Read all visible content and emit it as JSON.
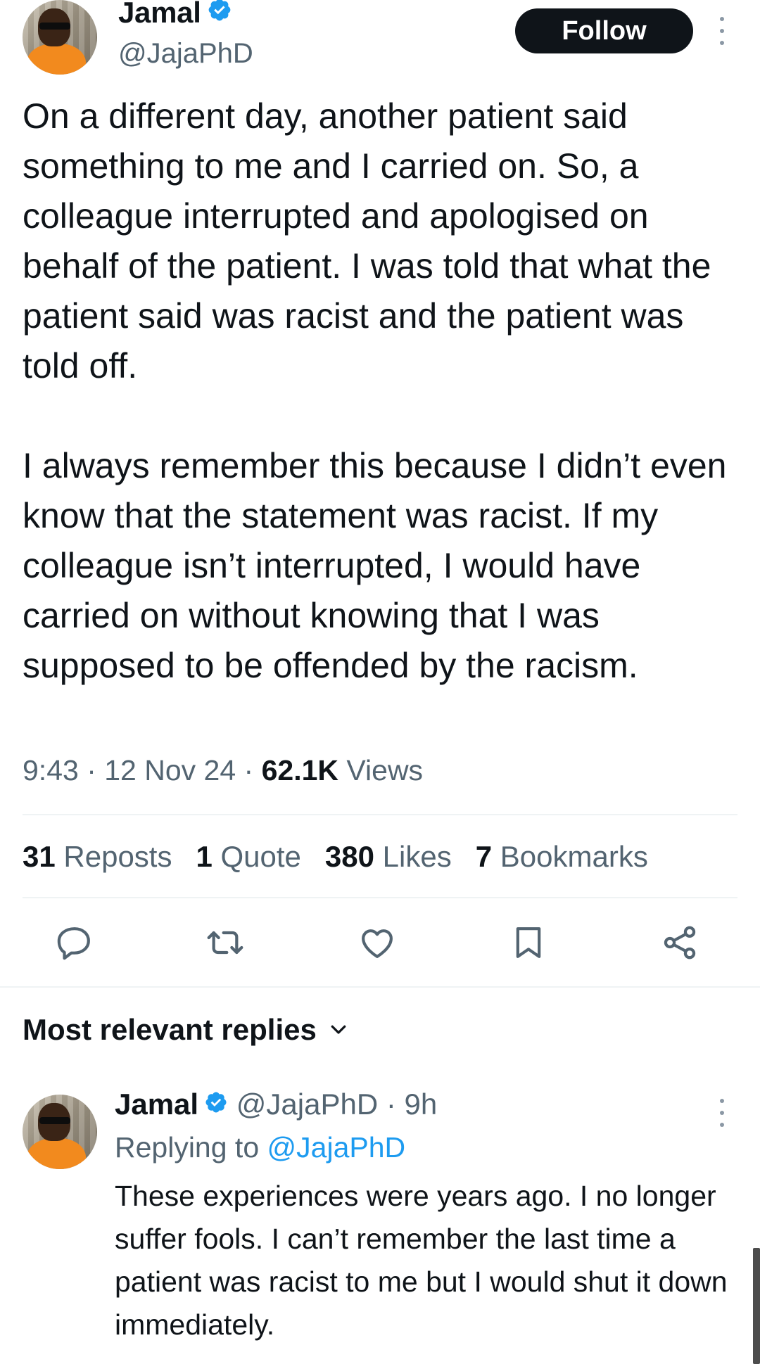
{
  "header": {
    "author_name": "Jamal",
    "author_handle": "@JajaPhD",
    "follow_label": "Follow"
  },
  "tweet": {
    "text": "On a different day, another patient said something to me and I carried on. So, a colleague interrupted and apologised on behalf of the patient. I was told that what the patient said was racist and the patient was told off.\n\nI always remember this because I didn’t even know that the statement was racist. If my colleague isn’t interrupted, I would have carried on without knowing that I was supposed to be offended by the racism.",
    "time": "9:43",
    "date": "12 Nov 24",
    "views_count": "62.1K",
    "views_label": "Views"
  },
  "stats": [
    {
      "count": "31",
      "label": "Reposts"
    },
    {
      "count": "1",
      "label": "Quote"
    },
    {
      "count": "380",
      "label": "Likes"
    },
    {
      "count": "7",
      "label": "Bookmarks"
    }
  ],
  "actions": {
    "icons": [
      "reply-icon",
      "repost-icon",
      "like-icon",
      "bookmark-icon",
      "share-icon"
    ]
  },
  "replies": {
    "heading": "Most relevant replies",
    "items": [
      {
        "author_name": "Jamal",
        "author_handle": "@JajaPhD",
        "time_ago": "9h",
        "replying_prefix": "Replying to",
        "replying_to": "@JajaPhD",
        "text": "These experiences were years ago. I no longer suffer fools. I can’t remember the last time a patient was racist to me but I would shut it down immediately."
      }
    ]
  },
  "colors": {
    "verified": "#1d9bf0",
    "link": "#1d9bf0",
    "muted": "#536471",
    "text": "#0f1419",
    "divider": "#eff3f4"
  }
}
